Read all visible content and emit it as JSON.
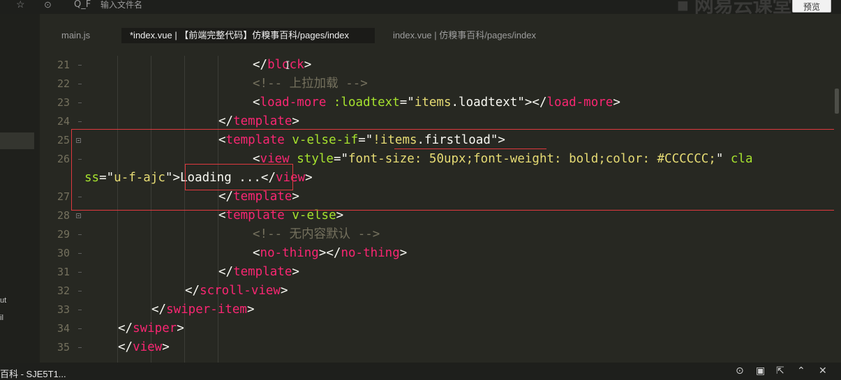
{
  "topbar": {
    "search_prefix": "Q_F",
    "search_placeholder": "输入文件名",
    "bg_text": "■ 网易云课堂",
    "preview_label": "预览"
  },
  "sidebar": {
    "items": [
      "ut",
      "il"
    ]
  },
  "tabs": [
    {
      "label": "main.js",
      "active": false
    },
    {
      "label": "*index.vue | 【前端完整代码】仿糗事百科/pages/index",
      "active": true
    },
    {
      "label": "index.vue | 仿糗事百科/pages/index",
      "active": false
    }
  ],
  "code": {
    "lines": [
      {
        "num": "21",
        "tokens": [
          {
            "t": "</",
            "c": "pun"
          },
          {
            "t": "block",
            "c": "tag"
          },
          {
            "t": ">",
            "c": "pun"
          }
        ]
      },
      {
        "num": "22",
        "tokens": [
          {
            "t": "<!-- 上拉加载 -->",
            "c": "cmt"
          }
        ]
      },
      {
        "num": "23",
        "tokens": [
          {
            "t": "<",
            "c": "pun"
          },
          {
            "t": "load-more",
            "c": "tag"
          },
          {
            "t": " ",
            "c": "txt"
          },
          {
            "t": ":loadtext",
            "c": "attr"
          },
          {
            "t": "=\"",
            "c": "pun"
          },
          {
            "t": "items",
            "c": "str"
          },
          {
            "t": ".loadtext",
            "c": "txt"
          },
          {
            "t": "\">",
            "c": "pun"
          },
          {
            "t": "</",
            "c": "pun"
          },
          {
            "t": "load-more",
            "c": "tag"
          },
          {
            "t": ">",
            "c": "pun"
          }
        ]
      },
      {
        "num": "24",
        "tokens": [
          {
            "t": "</",
            "c": "pun"
          },
          {
            "t": "template",
            "c": "tag"
          },
          {
            "t": ">",
            "c": "pun"
          }
        ]
      },
      {
        "num": "25",
        "tokens": [
          {
            "t": "<",
            "c": "pun"
          },
          {
            "t": "template",
            "c": "tag"
          },
          {
            "t": " ",
            "c": "txt"
          },
          {
            "t": "v-else-if",
            "c": "attr"
          },
          {
            "t": "=\"",
            "c": "pun"
          },
          {
            "t": "!items",
            "c": "str"
          },
          {
            "t": ".firstload",
            "c": "txt"
          },
          {
            "t": "\">",
            "c": "pun"
          }
        ]
      },
      {
        "num": "26",
        "tokens": [
          {
            "t": "<",
            "c": "pun"
          },
          {
            "t": "view",
            "c": "tag"
          },
          {
            "t": " ",
            "c": "txt"
          },
          {
            "t": "style",
            "c": "attr"
          },
          {
            "t": "=\"",
            "c": "pun"
          },
          {
            "t": "font-size: 50upx;font-weight: bold;color: #CCCCCC;",
            "c": "str"
          },
          {
            "t": "\"",
            "c": "pun"
          },
          {
            "t": " cla",
            "c": "attr"
          }
        ]
      },
      {
        "num": "",
        "tokens": [
          {
            "t": "ss",
            "c": "attr"
          },
          {
            "t": "=\"",
            "c": "pun"
          },
          {
            "t": "u-f-ajc",
            "c": "str"
          },
          {
            "t": "\">",
            "c": "pun"
          },
          {
            "t": "Loading ...",
            "c": "txt"
          },
          {
            "t": "</",
            "c": "pun"
          },
          {
            "t": "view",
            "c": "tag"
          },
          {
            "t": ">",
            "c": "pun"
          }
        ]
      },
      {
        "num": "27",
        "tokens": [
          {
            "t": "</",
            "c": "pun"
          },
          {
            "t": "template",
            "c": "tag"
          },
          {
            "t": ">",
            "c": "pun"
          }
        ]
      },
      {
        "num": "28",
        "tokens": [
          {
            "t": "<",
            "c": "pun"
          },
          {
            "t": "template",
            "c": "tag"
          },
          {
            "t": " ",
            "c": "txt"
          },
          {
            "t": "v-else",
            "c": "attr"
          },
          {
            "t": ">",
            "c": "pun"
          }
        ]
      },
      {
        "num": "29",
        "tokens": [
          {
            "t": "<!-- 无内容默认 -->",
            "c": "cmt"
          }
        ]
      },
      {
        "num": "30",
        "tokens": [
          {
            "t": "<",
            "c": "pun"
          },
          {
            "t": "no-thing",
            "c": "tag"
          },
          {
            "t": ">",
            "c": "pun"
          },
          {
            "t": "</",
            "c": "pun"
          },
          {
            "t": "no-thing",
            "c": "tag"
          },
          {
            "t": ">",
            "c": "pun"
          }
        ]
      },
      {
        "num": "31",
        "tokens": [
          {
            "t": "</",
            "c": "pun"
          },
          {
            "t": "template",
            "c": "tag"
          },
          {
            "t": ">",
            "c": "pun"
          }
        ]
      },
      {
        "num": "32",
        "tokens": [
          {
            "t": "</",
            "c": "pun"
          },
          {
            "t": "scroll-view",
            "c": "tag"
          },
          {
            "t": ">",
            "c": "pun"
          }
        ]
      },
      {
        "num": "33",
        "tokens": [
          {
            "t": "</",
            "c": "pun"
          },
          {
            "t": "swiper-item",
            "c": "tag"
          },
          {
            "t": ">",
            "c": "pun"
          }
        ]
      },
      {
        "num": "34",
        "tokens": [
          {
            "t": "</",
            "c": "pun"
          },
          {
            "t": "swiper",
            "c": "tag"
          },
          {
            "t": ">",
            "c": "pun"
          }
        ]
      },
      {
        "num": "35",
        "tokens": [
          {
            "t": "</",
            "c": "pun"
          },
          {
            "t": "view",
            "c": "tag"
          },
          {
            "t": ">",
            "c": "pun"
          }
        ]
      }
    ]
  },
  "status": {
    "project": "百科 - SJE5T1..."
  },
  "colors": {
    "editor_bg": "#272822",
    "tag": "#f92672",
    "attr": "#a6e22e",
    "string": "#e6db74",
    "comment": "#75715e",
    "highlight_box": "#e0393e"
  }
}
